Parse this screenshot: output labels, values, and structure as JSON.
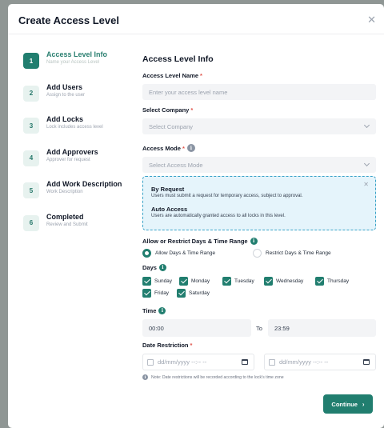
{
  "modal": {
    "title": "Create Access Level",
    "close_icon": "close-icon"
  },
  "steps": [
    {
      "num": "1",
      "title": "Access Level Info",
      "subtitle": "Name your Access Level",
      "active": true
    },
    {
      "num": "2",
      "title": "Add Users",
      "subtitle": "Assign to the user",
      "active": false
    },
    {
      "num": "3",
      "title": "Add Locks",
      "subtitle": "Lock includes access level",
      "active": false
    },
    {
      "num": "4",
      "title": "Add Approvers",
      "subtitle": "Approver for request",
      "active": false
    },
    {
      "num": "5",
      "title": "Add Work Description",
      "subtitle": "Work Description",
      "active": false
    },
    {
      "num": "6",
      "title": "Completed",
      "subtitle": "Review and Submit",
      "active": false
    }
  ],
  "form": {
    "section_title": "Access Level Info",
    "name_label": "Access Level Name",
    "name_placeholder": "Enter your access level name",
    "company_label": "Select Company",
    "company_placeholder": "Select Company",
    "mode_label": "Access Mode",
    "mode_placeholder": "Select Access Mode",
    "required_mark": "*",
    "info_glyph": "i",
    "mode_options": [
      {
        "title": "By Request",
        "desc": "Users must submit a request for temporary access, subject to approval."
      },
      {
        "title": "Auto Access",
        "desc": "Users are automatically granted access to all locks in this level."
      }
    ],
    "range_label": "Allow or Restrict Days & Time Range",
    "radio_allow": "Allow Days & Time Range",
    "radio_restrict": "Restrict Days & Time Range",
    "radio_selected": "allow",
    "days_label": "Days",
    "days": [
      {
        "name": "Sunday",
        "checked": true
      },
      {
        "name": "Monday",
        "checked": true
      },
      {
        "name": "Tuesday",
        "checked": true
      },
      {
        "name": "Wednesday",
        "checked": true
      },
      {
        "name": "Thursday",
        "checked": true
      },
      {
        "name": "Friday",
        "checked": true
      },
      {
        "name": "Saturday",
        "checked": true
      }
    ],
    "time_label": "Time",
    "time_from": "00:00",
    "time_to_label": "To",
    "time_to": "23:59",
    "date_label": "Date Restriction",
    "date_from": "dd/mm/yyyy --:-- --",
    "date_to": "dd/mm/yyyy --:-- --",
    "date_note": "Note: Date restrictions will be recorded according to the lock's time zone"
  },
  "actions": {
    "continue_label": "Continue",
    "continue_arrow": "›"
  },
  "colors": {
    "accent": "#217e6f",
    "popup_bg": "#e5f4fb",
    "popup_border": "#3aa3c8",
    "required": "#e0534a"
  }
}
